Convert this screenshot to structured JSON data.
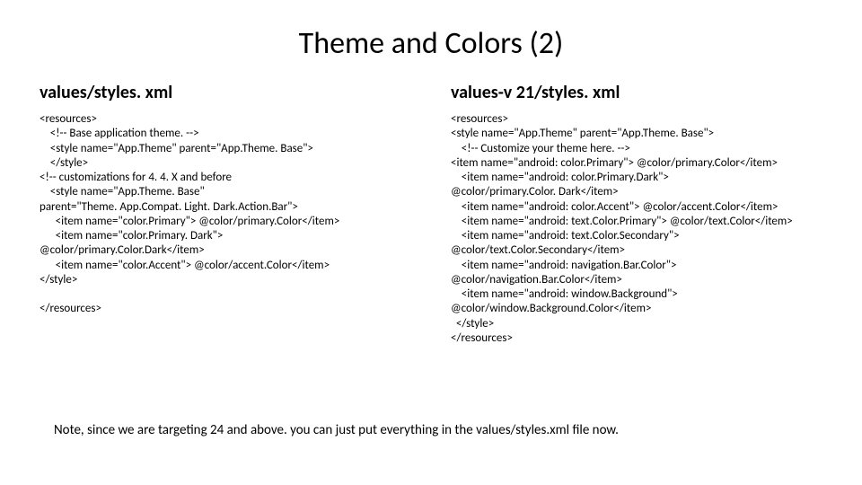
{
  "title": "Theme and Colors (2)",
  "left": {
    "heading": "values/styles. xml",
    "code": "<resources>\n    <!-- Base application theme. -->\n    <style name=\"App.Theme\" parent=\"App.Theme. Base\">\n    </style>\n<!-- customizations for 4. 4. X and before\n    <style name=\"App.Theme. Base\"\nparent=\"Theme. App.Compat. Light. Dark.Action.Bar\">\n      <item name=\"color.Primary\"> @color/primary.Color</item>\n      <item name=\"color.Primary. Dark\">\n@color/primary.Color.Dark</item>\n      <item name=\"color.Accent\"> @color/accent.Color</item>\n</style>\n\n</resources>"
  },
  "right": {
    "heading": "values-v 21/styles. xml",
    "code": "<resources>\n<style name=\"App.Theme\" parent=\"App.Theme. Base\">\n    <!-- Customize your theme here. -->\n<item name=\"android: color.Primary\"> @color/primary.Color</item>\n    <item name=\"android: color.Primary.Dark\">\n@color/primary.Color. Dark</item>\n    <item name=\"android: color.Accent\"> @color/accent.Color</item>\n    <item name=\"android: text.Color.Primary\"> @color/text.Color</item>\n    <item name=\"android: text.Color.Secondary\">\n@color/text.Color.Secondary</item>\n    <item name=\"android: navigation.Bar.Color\">\n@color/navigation.Bar.Color</item>\n    <item name=\"android: window.Background\">\n@color/window.Background.Color</item>\n  </style>\n</resources>"
  },
  "footnote": "Note, since we are targeting 24 and above.  you can just put everything in the values/styles.xml file now."
}
